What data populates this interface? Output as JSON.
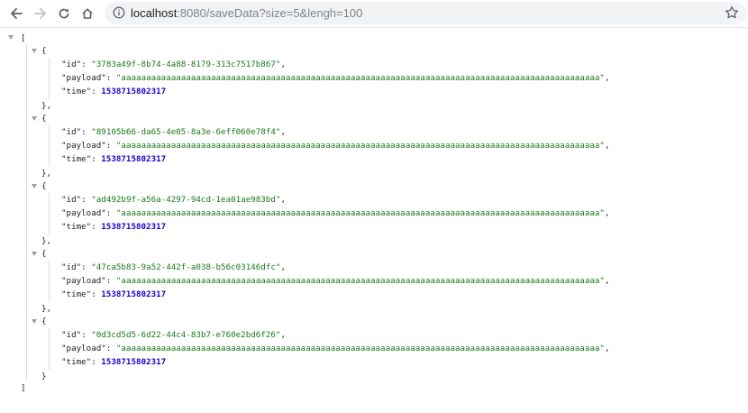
{
  "browser": {
    "url_host": "localhost",
    "url_rest": ":8080/saveData?size=5&lengh=100"
  },
  "json": {
    "open_bracket": "[",
    "close_bracket": "]",
    "items": [
      {
        "id": "3783a49f-8b74-4a88-8179-313c7517b867",
        "payload": "aaaaaaaaaaaaaaaaaaaaaaaaaaaaaaaaaaaaaaaaaaaaaaaaaaaaaaaaaaaaaaaaaaaaaaaaaaaaaaaaaaaaaaaaaaaaaaaa",
        "time": "1538715802317"
      },
      {
        "id": "89105b66-da65-4e05-8a3e-6eff060e78f4",
        "payload": "aaaaaaaaaaaaaaaaaaaaaaaaaaaaaaaaaaaaaaaaaaaaaaaaaaaaaaaaaaaaaaaaaaaaaaaaaaaaaaaaaaaaaaaaaaaaaaaa",
        "time": "1538715802317"
      },
      {
        "id": "ad492b9f-a56a-4297-94cd-1ea01ae983bd",
        "payload": "aaaaaaaaaaaaaaaaaaaaaaaaaaaaaaaaaaaaaaaaaaaaaaaaaaaaaaaaaaaaaaaaaaaaaaaaaaaaaaaaaaaaaaaaaaaaaaaa",
        "time": "1538715802317"
      },
      {
        "id": "47ca5b83-9a52-442f-a038-b56c03146dfc",
        "payload": "aaaaaaaaaaaaaaaaaaaaaaaaaaaaaaaaaaaaaaaaaaaaaaaaaaaaaaaaaaaaaaaaaaaaaaaaaaaaaaaaaaaaaaaaaaaaaaaa",
        "time": "1538715802317"
      },
      {
        "id": "0d3cd5d5-6d22-44c4-83b7-e760e2bd6f26",
        "payload": "aaaaaaaaaaaaaaaaaaaaaaaaaaaaaaaaaaaaaaaaaaaaaaaaaaaaaaaaaaaaaaaaaaaaaaaaaaaaaaaaaaaaaaaaaaaaaaaa",
        "time": "1538715802317"
      }
    ]
  }
}
